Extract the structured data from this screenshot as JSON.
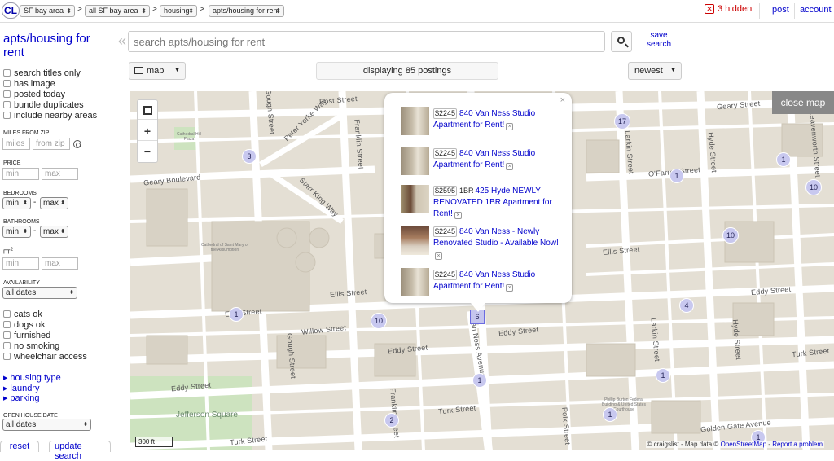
{
  "header": {
    "logo": "CL",
    "breadcrumbs": [
      {
        "label": "SF bay area"
      },
      {
        "label": "all SF bay area"
      },
      {
        "label": "housing"
      },
      {
        "label": "apts/housing for rent"
      }
    ],
    "crumb_separator": ">",
    "hidden_count": "3 hidden",
    "post_link": "post",
    "account_link": "account"
  },
  "sidebar": {
    "category_title": "apts/housing for rent",
    "checks_top": [
      "search titles only",
      "has image",
      "posted today",
      "bundle duplicates",
      "include nearby areas"
    ],
    "miles_label": "MILES FROM ZIP",
    "miles_placeholder": "miles",
    "zip_placeholder": "from zip",
    "price_label": "PRICE",
    "min_placeholder": "min",
    "max_placeholder": "max",
    "bedrooms_label": "BEDROOMS",
    "bedrooms_min": "min",
    "bedrooms_max": "max",
    "bathrooms_label": "BATHROOMS",
    "bathrooms_min": "min",
    "bathrooms_max": "max",
    "ft2_label": "FT",
    "ft2_sup": "2",
    "ft_min_placeholder": "min",
    "ft_max_placeholder": "max",
    "availability_label": "AVAILABILITY",
    "availability_value": "all dates",
    "checks_bottom": [
      "cats ok",
      "dogs ok",
      "furnished",
      "no smoking",
      "wheelchair access"
    ],
    "expanders": [
      "housing type",
      "laundry",
      "parking"
    ],
    "open_house_label": "OPEN HOUSE DATE",
    "open_house_value": "all dates",
    "reset_label": "reset",
    "update_label": "update search",
    "range_dash": "-"
  },
  "search": {
    "placeholder": "search apts/housing for rent",
    "save_label_1": "save",
    "save_label_2": "search",
    "collapse_glyph": "«"
  },
  "toolbar": {
    "view_mode": "map",
    "displaying": "displaying 85 postings",
    "sort": "newest"
  },
  "map": {
    "close_map": "close map",
    "scale": "300 ft",
    "attribution_prefix": "© craigslist - Map data ©",
    "attribution_osm": "OpenStreetMap",
    "attribution_sep": "-",
    "attribution_report": "Report a problem",
    "clusters": [
      "3",
      "17",
      "1",
      "10",
      "10",
      "1",
      "1",
      "10",
      "4",
      "6",
      "1",
      "1",
      "2",
      "1",
      "1"
    ],
    "street_labels": [
      "Post Street",
      "Geary Street",
      "Geary Boulevard",
      "Gough Street",
      "Franklin Street",
      "Peter Yorke Way",
      "Starr King Way",
      "Ellis Street",
      "Ellis Street",
      "Ellis Street",
      "Willow Street",
      "Eddy Street",
      "Eddy Street",
      "Eddy Street",
      "Eddy Street",
      "Turk Street",
      "Turk Street",
      "Turk Street",
      "Larkin Street",
      "Hyde Street",
      "Leavenworth Street",
      "O'Farrell Street",
      "Van Ness Avenue",
      "Golden Gate Avenue",
      "Polk Street",
      "Gough Street",
      "Franklin Street",
      "Larkin Street",
      "Hyde Street"
    ],
    "park_labels": [
      "Jefferson Square",
      "Cathedral Hill Plaza",
      "Cathedral of Saint Mary of the Assumption",
      "Phillip Burton Federal Building & United States Courthouse"
    ]
  },
  "popup": {
    "close": "×",
    "listings": [
      {
        "price": "$2245",
        "bedrooms": "",
        "title": "840 Van Ness Studio Apartment for Rent!"
      },
      {
        "price": "$2245",
        "bedrooms": "",
        "title": "840 Van Ness Studio Apartment for Rent!"
      },
      {
        "price": "$2595",
        "bedrooms": "1BR",
        "title": "425 Hyde NEWLY RENOVATED 1BR Apartment for Rent!"
      },
      {
        "price": "$2245",
        "bedrooms": "",
        "title": "840 Van Ness - Newly Renovated Studio - Available Now!"
      },
      {
        "price": "$2245",
        "bedrooms": "",
        "title": "840 Van Ness Studio Apartment for Rent!"
      }
    ]
  },
  "colors": {
    "link": "#0000cc",
    "map_bg": "#e9e5dc",
    "road": "#ffffff",
    "park": "#cde3bf",
    "cluster": "#c8c8ef"
  }
}
